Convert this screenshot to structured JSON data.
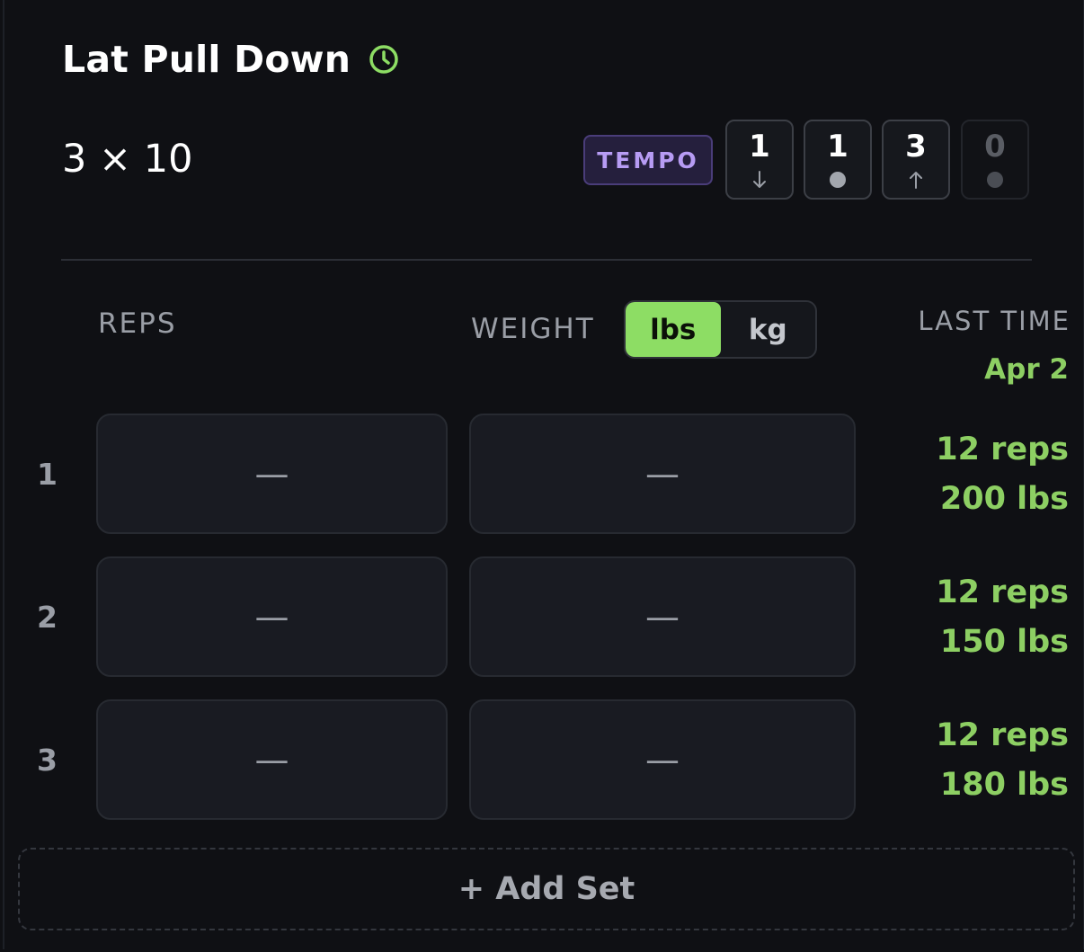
{
  "exercise": {
    "title": "Lat Pull Down",
    "icon": "clock-icon",
    "target": "3 × 10"
  },
  "tempo": {
    "label": "TEMPO",
    "phases": [
      {
        "value": "1",
        "mark": "↓",
        "icon": "arrow-down-icon",
        "dim": false
      },
      {
        "value": "1",
        "mark": "●",
        "icon": "pause-dot-icon",
        "dim": false
      },
      {
        "value": "3",
        "mark": "↑",
        "icon": "arrow-up-icon",
        "dim": false
      },
      {
        "value": "0",
        "mark": "●",
        "icon": "pause-dot-icon",
        "dim": true
      }
    ]
  },
  "columns": {
    "reps": "REPS",
    "weight": "WEIGHT",
    "last_time": "LAST TIME"
  },
  "units": {
    "options": [
      "lbs",
      "kg"
    ],
    "selected": "lbs"
  },
  "last_session": {
    "date": "Apr 2"
  },
  "sets": [
    {
      "number": "1",
      "reps": "—",
      "weight": "—",
      "last_reps": "12 reps",
      "last_weight": "200 lbs"
    },
    {
      "number": "2",
      "reps": "—",
      "weight": "—",
      "last_reps": "12 reps",
      "last_weight": "150 lbs"
    },
    {
      "number": "3",
      "reps": "—",
      "weight": "—",
      "last_reps": "12 reps",
      "last_weight": "180 lbs"
    }
  ],
  "add_set_label": "+ Add Set",
  "colors": {
    "accent_green": "#8ddd64",
    "last_time_green": "#8dcf63",
    "tempo_purple": "#b79cf4",
    "background": "#0f1014"
  }
}
